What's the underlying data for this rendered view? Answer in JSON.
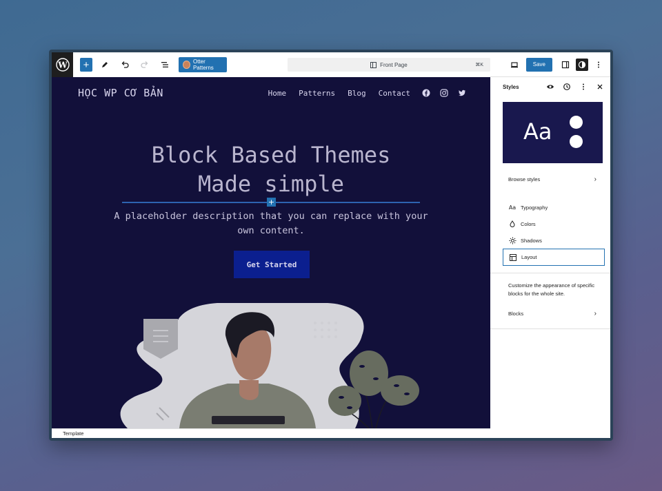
{
  "toolbar": {
    "otter_label": "Otter Patterns",
    "page_title": "Front Page",
    "shortcut": "⌘K"
  },
  "site": {
    "title": "HỌC WP CƠ BẢN",
    "nav": [
      "Home",
      "Patterns",
      "Blog",
      "Contact"
    ]
  },
  "hero": {
    "title_line1": "Block Based Themes",
    "title_line2": "Made simple",
    "description": "A placeholder description that you can replace with your own content.",
    "cta": "Get Started"
  },
  "status": {
    "label": "Template"
  },
  "sidebar": {
    "save_label": "Save",
    "panel_title": "Styles",
    "preview_text": "Aa",
    "browse_styles": "Browse styles",
    "items": [
      "Typography",
      "Colors",
      "Shadows",
      "Layout"
    ],
    "blocks_description": "Customize the appearance of specific blocks for the whole site.",
    "blocks_label": "Blocks"
  },
  "colors": {
    "accent": "#2271b1",
    "canvas_bg": "#12103a",
    "cta_bg": "#0b1f8f"
  },
  "icons": {
    "wp": "wordpress-logo-icon",
    "social": [
      "facebook-icon",
      "instagram-icon",
      "twitter-icon"
    ]
  }
}
